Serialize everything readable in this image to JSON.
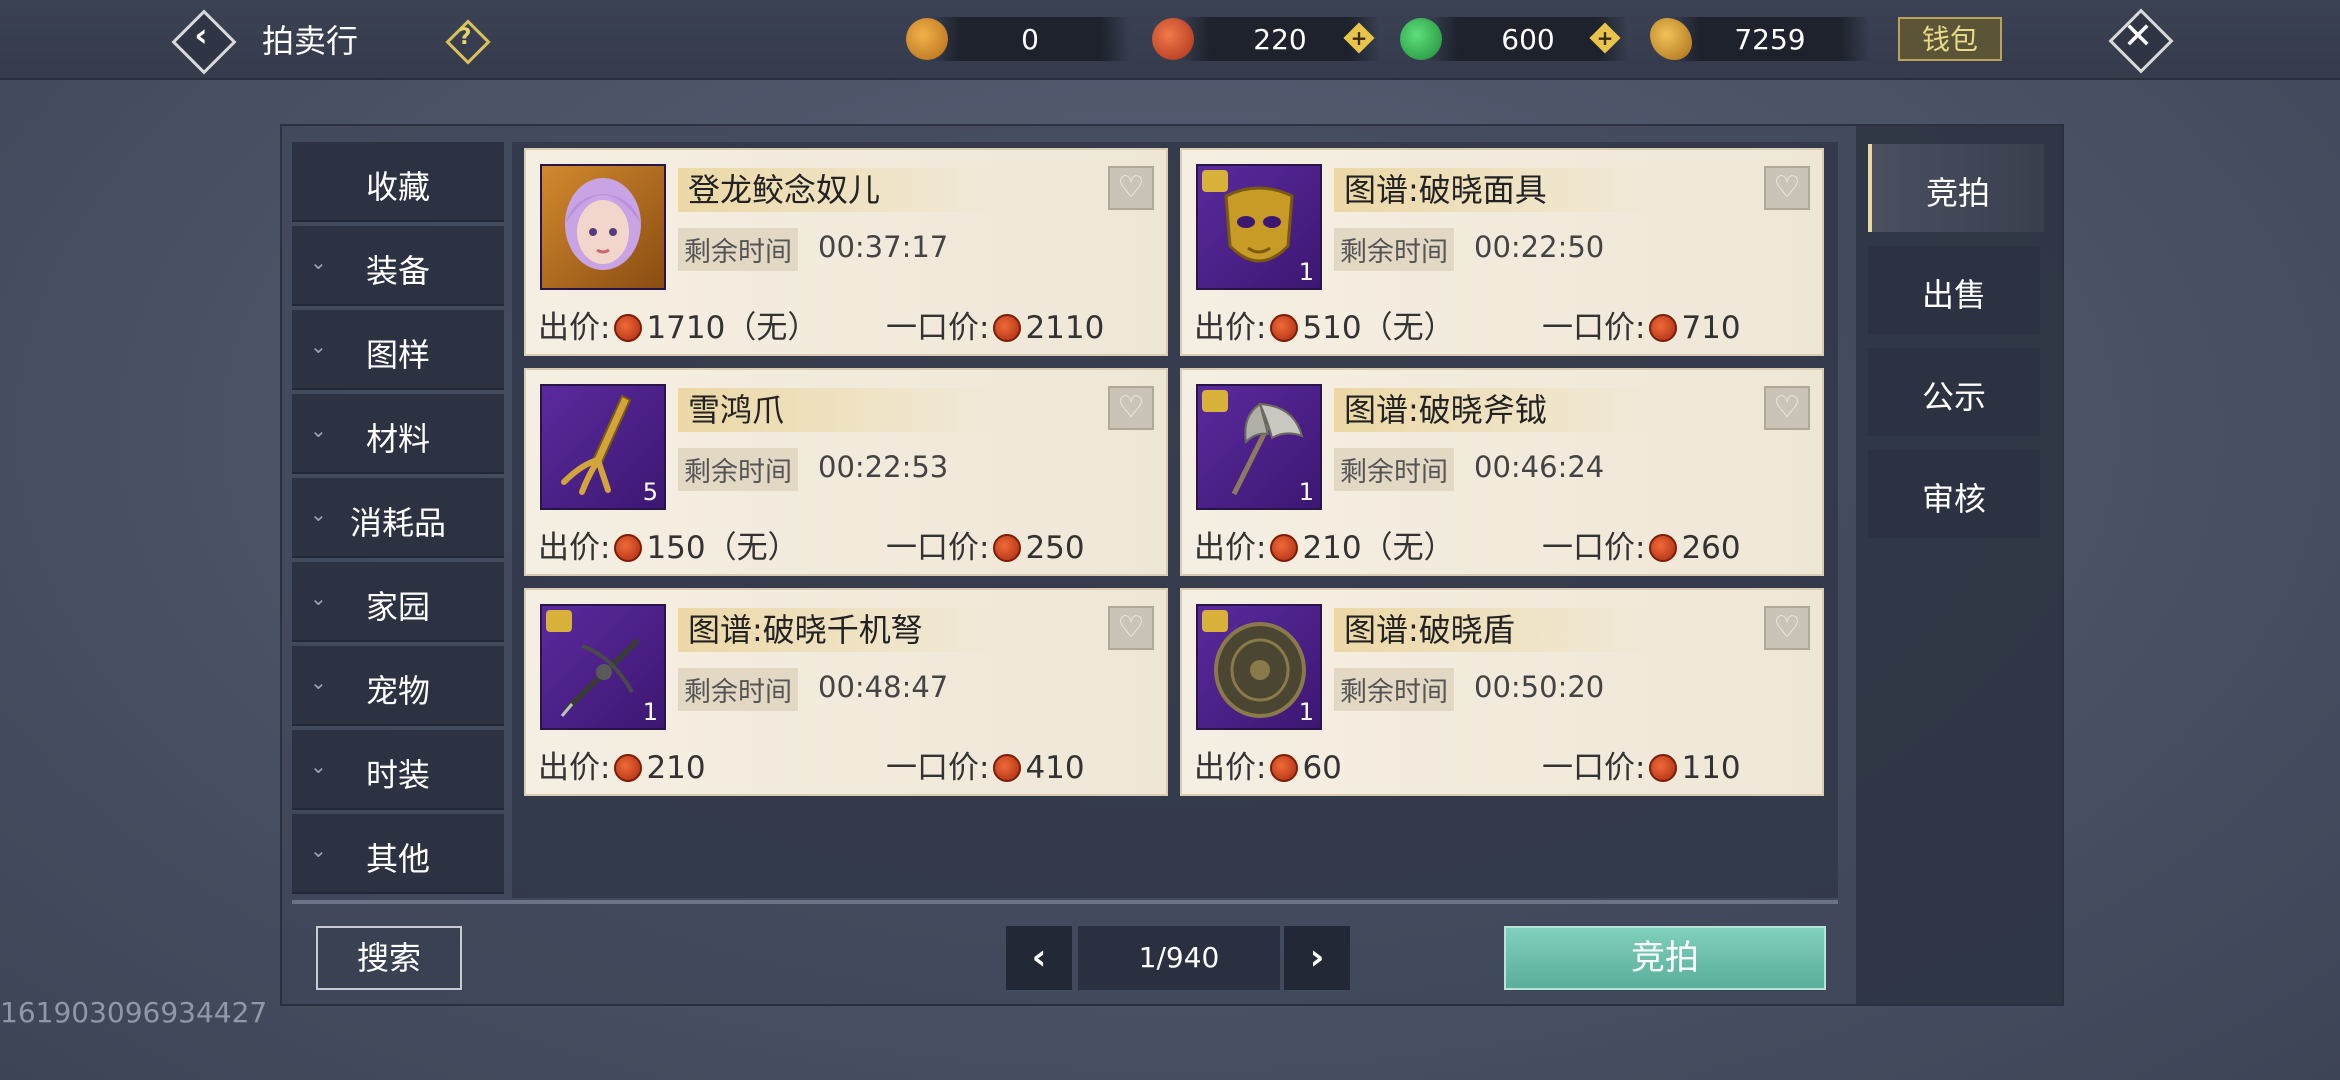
{
  "header": {
    "title": "拍卖行",
    "help_icon": "question-icon",
    "currencies": [
      {
        "icon": "copper-coin-icon",
        "value": "0",
        "color": "#e0922e"
      },
      {
        "icon": "red-coin-icon",
        "value": "220",
        "color": "#d2502a"
      },
      {
        "icon": "jade-coin-icon",
        "value": "600",
        "color": "#2fa84a"
      },
      {
        "icon": "gold-ingot-icon",
        "value": "7259",
        "color": "#c9962e"
      }
    ],
    "wallet_label": "钱包"
  },
  "left_nav": {
    "items": [
      {
        "label": "收藏",
        "has_arrow": false
      },
      {
        "label": "装备",
        "has_arrow": true
      },
      {
        "label": "图样",
        "has_arrow": true
      },
      {
        "label": "材料",
        "has_arrow": true
      },
      {
        "label": "消耗品",
        "has_arrow": true
      },
      {
        "label": "家园",
        "has_arrow": true
      },
      {
        "label": "宠物",
        "has_arrow": true
      },
      {
        "label": "时装",
        "has_arrow": true
      },
      {
        "label": "其他",
        "has_arrow": true
      }
    ]
  },
  "listings": [
    {
      "name": "登龙鲛念奴儿",
      "time_label": "剩余时间",
      "time": "00:37:17",
      "bid_label": "出价:",
      "bid": "1710（无）",
      "buyout_label": "一口价:",
      "buyout": "2110",
      "count": "",
      "icon": "character-portrait-icon"
    },
    {
      "name": "图谱:破晓面具",
      "time_label": "剩余时间",
      "time": "00:22:50",
      "bid_label": "出价:",
      "bid": "510（无）",
      "buyout_label": "一口价:",
      "buyout": "710",
      "count": "1",
      "icon": "mask-icon"
    },
    {
      "name": "雪鸿爪",
      "time_label": "剩余时间",
      "time": "00:22:53",
      "bid_label": "出价:",
      "bid": "150（无）",
      "buyout_label": "一口价:",
      "buyout": "250",
      "count": "5",
      "icon": "claw-icon"
    },
    {
      "name": "图谱:破晓斧钺",
      "time_label": "剩余时间",
      "time": "00:46:24",
      "bid_label": "出价:",
      "bid": "210（无）",
      "buyout_label": "一口价:",
      "buyout": "260",
      "count": "1",
      "icon": "axe-icon"
    },
    {
      "name": "图谱:破晓千机弩",
      "time_label": "剩余时间",
      "time": "00:48:47",
      "bid_label": "出价:",
      "bid": "210",
      "buyout_label": "一口价:",
      "buyout": "410",
      "count": "1",
      "icon": "crossbow-icon"
    },
    {
      "name": "图谱:破晓盾",
      "time_label": "剩余时间",
      "time": "00:50:20",
      "bid_label": "出价:",
      "bid": "60",
      "buyout_label": "一口价:",
      "buyout": "110",
      "count": "1",
      "icon": "shield-icon"
    }
  ],
  "footer": {
    "search_label": "搜索",
    "page": "1/940",
    "bid_button": "竞拍"
  },
  "right_nav": {
    "items": [
      {
        "label": "竞拍",
        "active": true
      },
      {
        "label": "出售",
        "active": false
      },
      {
        "label": "公示",
        "active": false
      },
      {
        "label": "审核",
        "active": false
      }
    ]
  },
  "watermark": "161903096934427"
}
